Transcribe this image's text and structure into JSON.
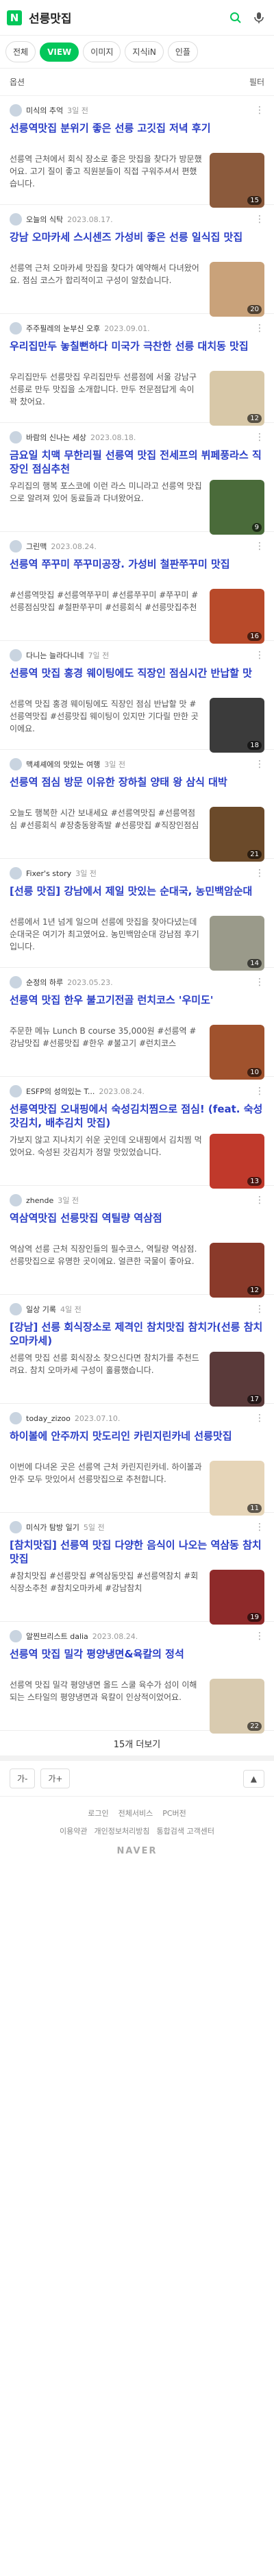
{
  "header": {
    "logo": "N",
    "query": "선릉맛집"
  },
  "tabs": [
    {
      "label": "전체",
      "active": false
    },
    {
      "label": "VIEW",
      "active": true
    },
    {
      "label": "이미지",
      "active": false
    },
    {
      "label": "지식iN",
      "active": false
    },
    {
      "label": "인플",
      "active": false
    }
  ],
  "options": {
    "left": "옵션",
    "right": "필터"
  },
  "results": [
    {
      "author": "미식의 추억",
      "date": "3일 전",
      "title": "선릉역맛집 분위기 좋은 선릉 고깃집 저녁 후기",
      "desc": "선릉역 근처에서 회식 장소로 좋은 맛집을 찾다가 방문했어요. 고기 질이 좋고 직원분들이 직접 구워주셔서 편했습니다.",
      "thumb": "#8b5a3c",
      "count": "15"
    },
    {
      "author": "오늘의 식탁",
      "date": "2023.08.17.",
      "title": "강남 오마카세 스시센즈 가성비 좋은 선릉 일식집 맛집",
      "desc": "선릉역 근처 오마카세 맛집을 찾다가 예약해서 다녀왔어요. 점심 코스가 합리적이고 구성이 알찼습니다.",
      "thumb": "#c9a27a",
      "count": "20"
    },
    {
      "author": "주주필레의 눈부신 오후",
      "date": "2023.09.01.",
      "title": "우리집만두 놓칠뻔하다 미국가 극찬한 선릉 대치동 맛집",
      "desc": "우리집만두 선릉맛집 우리집만두 선릉점에 서울 강남구 선릉로 만두 맛집을 소개합니다. 만두 전문점답게 속이 꽉 찼어요.",
      "thumb": "#d8c8a8",
      "count": "12"
    },
    {
      "author": "바람의 신나는 세상",
      "date": "2023.08.18.",
      "title": "금요일 치맥 무한리필 선릉역 맛집 전세프의 뷔페풍라스 직장인 점심추천",
      "desc": "우리집의 행복 포스코에 이런 라스 미니라고 선릉역 맛집으로 알려져 있어 동료들과 다녀왔어요.",
      "thumb": "#4a6b3a",
      "count": "9"
    },
    {
      "author": "그린맥",
      "date": "2023.08.24.",
      "title": "선릉역 쭈꾸미 쭈꾸미공장. 가성비 철판쭈꾸미 맛집",
      "desc": "#선릉역맛집 #선릉역쭈꾸미 #선릉쭈꾸미 #쭈꾸미 #선릉점심맛집 #철판쭈꾸미 #선릉회식 #선릉맛집추천",
      "thumb": "#b84a2a",
      "count": "16"
    },
    {
      "author": "다니는 늘라다니네",
      "date": "7일 전",
      "title": "선릉역 맛집 홍경 웨이팅에도 직장인 점심시간 반납할 맛",
      "desc": "선릉역 맛집 홍경 웨이팅에도 직장인 점심 반납할 맛 #선릉역맛집 #선릉맛집 웨이팅이 있지만 기다릴 만한 곳이에요.",
      "thumb": "#3b3b3b",
      "count": "18"
    },
    {
      "author": "맥셰셰에의 맛있는 여행",
      "date": "3일 전",
      "title": "선릉역 점심 방문 이유한 장하칠 양태 왕 삼식 대박",
      "desc": "오늘도 행복한 시간 보내세요 #선릉역맛집 #선릉역점심 #선릉회식 #장충동왕족발 #선릉맛집 #직장인점심",
      "thumb": "#6b4a2a",
      "count": "21"
    },
    {
      "author": "Fixer's story",
      "date": "3일 전",
      "title": "[선릉 맛집] 강남에서 제일 맛있는 순대국, 농민백암순대",
      "desc": "선릉에서 1년 넘게 일으며 선릉에 맛집을 찾아다녔는데 순대국은 여기가 최고였어요. 농민백암순대 강남점 후기입니다.",
      "thumb": "#9a9a8a",
      "count": "14"
    },
    {
      "author": "순정의 하루",
      "date": "2023.05.23.",
      "title": "선릉역 맛집 한우 불고기전골 런치코스 '우미도'",
      "desc": "주문한 메뉴 Lunch B course 35,000원 #선릉역 #강남맛집 #선릉맛집 #한우 #불고기 #런치코스",
      "thumb": "#a0522d",
      "count": "10"
    },
    {
      "author": "ESFP의 성의있는 T...",
      "date": "2023.08.24.",
      "title": "선릉역맛집 오내핑에서 숙성김치찜으로 점심! (feat. 숙성갓김치, 배추김치 맛집)",
      "desc": "가보지 않고 지나치기 쉬운 곳인데 오내핑에서 김치찜 먹었어요. 숙성된 갓김치가 정말 맛있었습니다.",
      "thumb": "#c0392b",
      "count": "13"
    },
    {
      "author": "zhende",
      "date": "3일 전",
      "title": "역삼역맛집 선릉맛집 역틸량 역삼점",
      "desc": "역삼역 선릉 근처 직장인들의 필수코스, 역틸량 역삼점. 선릉맛집으로 유명한 곳이에요. 얼큰한 국물이 좋아요.",
      "thumb": "#8a3a2a",
      "count": "12"
    },
    {
      "author": "일상 기록",
      "date": "4일 전",
      "title": "[강남] 선릉 회식장소로 제격인 참치맛집 참치가(선릉 참치 오마카세)",
      "desc": "선릉역 맛집 선릉 회식장소 찾으신다면 참치가를 추천드려요. 참치 오마카세 구성이 훌륭했습니다.",
      "thumb": "#5a3a3a",
      "count": "17"
    },
    {
      "author": "today_zizoo",
      "date": "2023.07.10.",
      "title": "하이볼에 안주까지 맛도리인 카린지린카네 선릉맛집",
      "desc": "이번에 다녀온 곳은 선릉역 근처 카린지린카네. 하이볼과 안주 모두 맛있어서 선릉맛집으로 추천합니다.",
      "thumb": "#e6d5b8",
      "count": "11"
    },
    {
      "author": "미식가 탐방 일기",
      "date": "5일 전",
      "title": "[참치맛집] 선릉역 맛집 다양한 음식이 나오는 역삼동 참치 맛집",
      "desc": "#참치맛집 #선릉맛집 #역삼동맛집 #선릉역참치 #회식장소추천 #참치오마카세 #강남참치",
      "thumb": "#8e2a2a",
      "count": "19"
    },
    {
      "author": "알찐브리스트 dalia",
      "date": "2023.08.24.",
      "title": "선릉역 맛집 밀각 평양냉면&육칼의 정석",
      "desc": "선릉역 맛집 밀각 평양냉면 올드 스쿨 육수가 섬이 이해되는 스타일의 평양냉면과 육칼이 인상적이었어요.",
      "thumb": "#d9cbb0",
      "count": "22"
    }
  ],
  "more": {
    "label": "15개 더보기"
  },
  "pager": {
    "left": "가-",
    "right": "가+"
  },
  "footer": {
    "links": [
      "로그인",
      "전체서비스",
      "PC버전"
    ],
    "links2": [
      "이용약관",
      "개인정보처리방침",
      "통합검색 고객센터"
    ],
    "brand": "NAVER"
  }
}
